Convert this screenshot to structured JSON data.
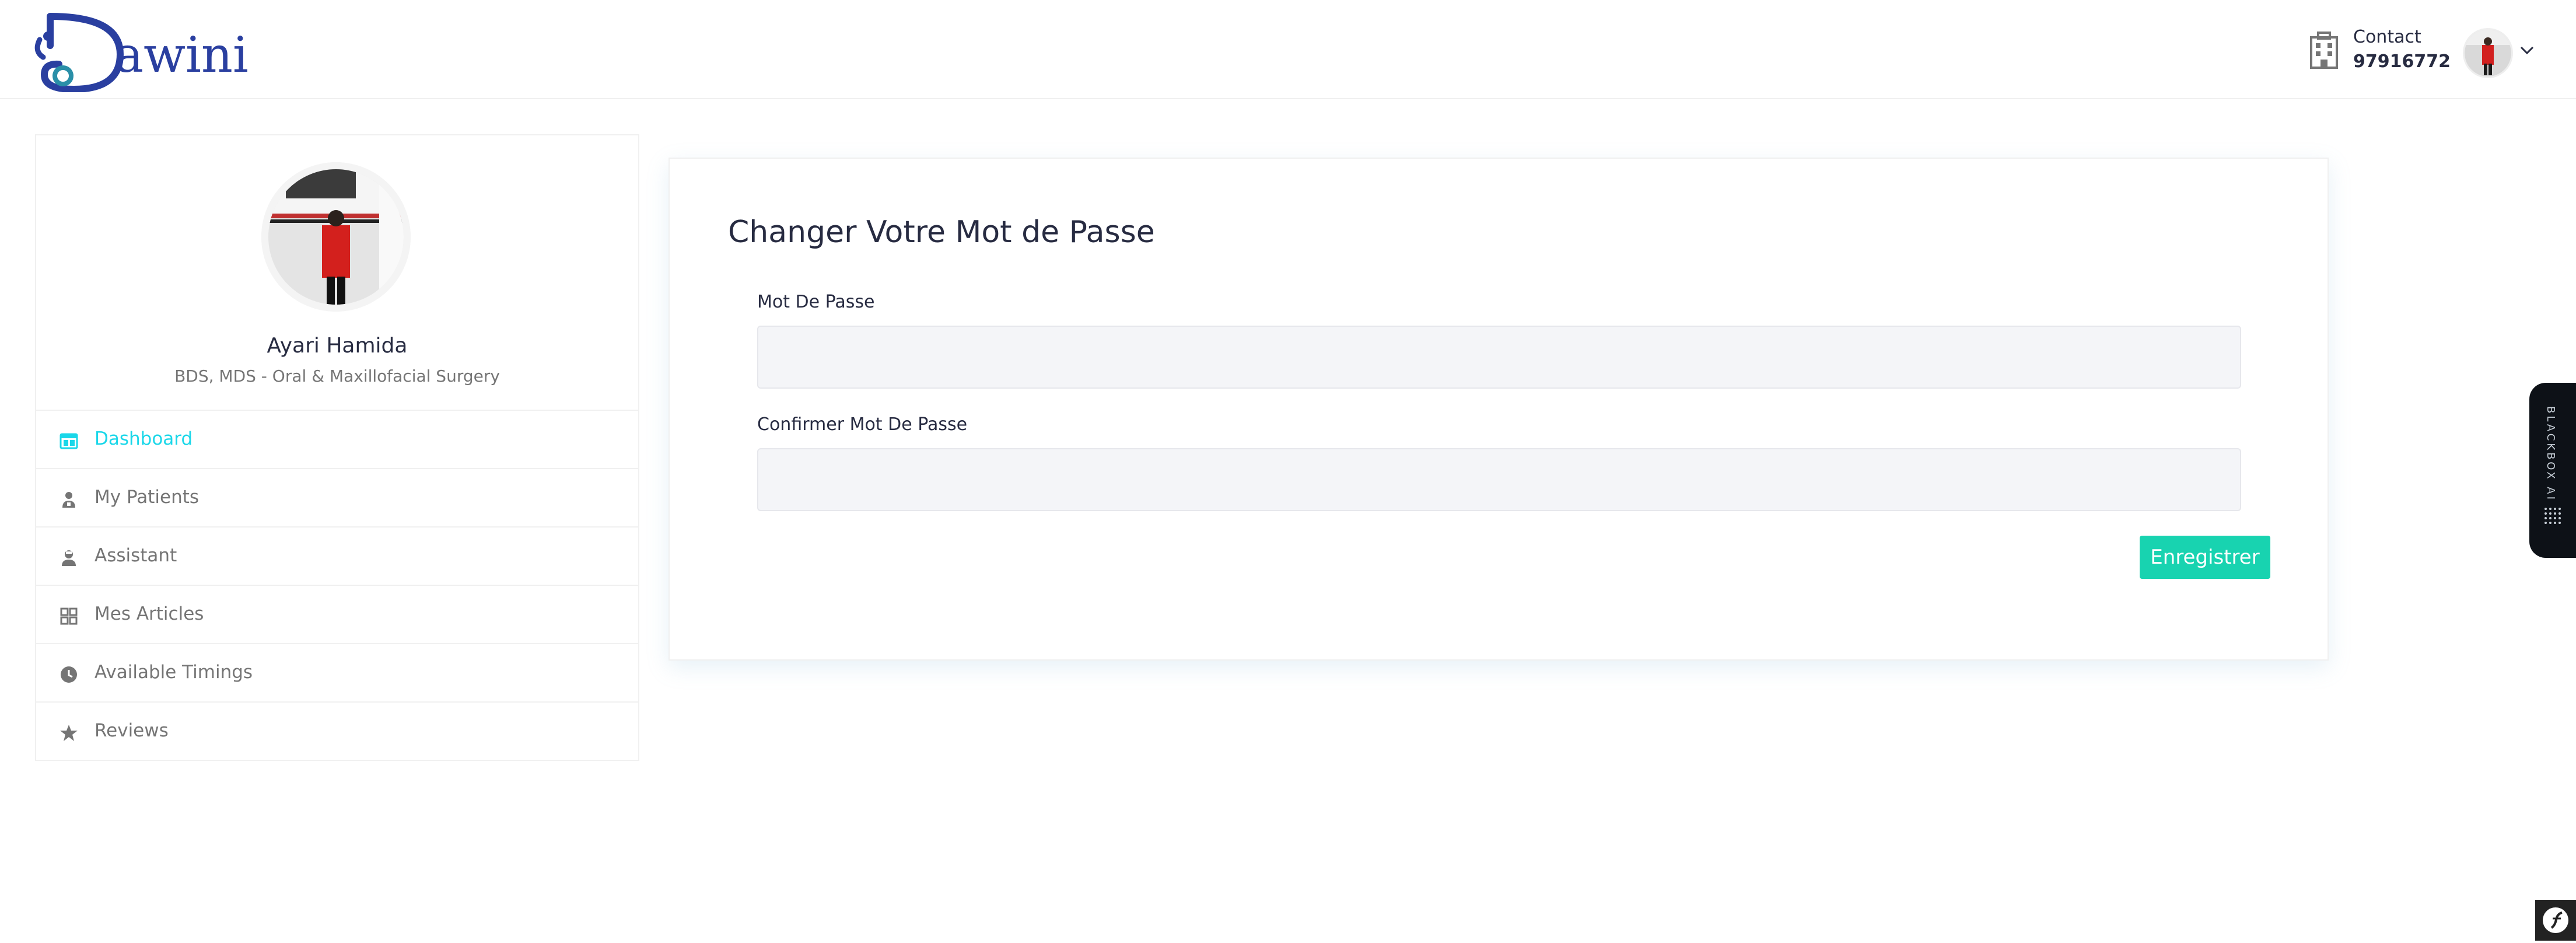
{
  "header": {
    "logo_text_first": "D",
    "logo_text_rest": "awini",
    "contact_label": "Contact",
    "contact_number": "97916772"
  },
  "sidebar": {
    "profile_name": "Ayari Hamida",
    "profile_specialty": "BDS, MDS - Oral & Maxillofacial Surgery",
    "items": [
      {
        "label": "Dashboard",
        "icon": "dashboard-icon",
        "active": true
      },
      {
        "label": "My Patients",
        "icon": "patients-icon",
        "active": false
      },
      {
        "label": "Assistant",
        "icon": "assistant-icon",
        "active": false
      },
      {
        "label": "Mes Articles",
        "icon": "grid-icon",
        "active": false
      },
      {
        "label": "Available Timings",
        "icon": "clock-icon",
        "active": false
      },
      {
        "label": "Reviews",
        "icon": "star-icon",
        "active": false
      }
    ]
  },
  "main": {
    "title": "Changer Votre Mot de Passe",
    "password_label": "Mot De Passe",
    "password_value": "",
    "confirm_label": "Confirmer Mot De Passe",
    "confirm_value": "",
    "save_label": "Enregistrer"
  },
  "blackbox": {
    "label": "BLACKBOX AI"
  },
  "colors": {
    "accent": "#1ad7e9",
    "button": "#18d3b0",
    "text": "#272b41",
    "muted": "#757575"
  }
}
